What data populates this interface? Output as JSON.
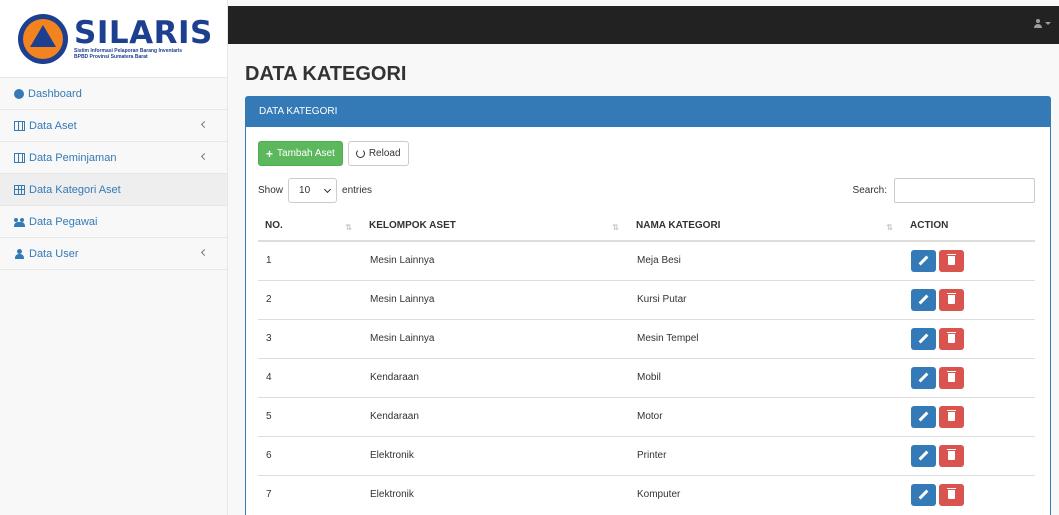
{
  "brand": {
    "title": "SILARIS",
    "subtitle_1": "Sistim Informasi Pelaporan Barang Inventaris",
    "subtitle_2": "BPBD Provinsi Sumatera Barat"
  },
  "sidebar": {
    "items": [
      {
        "label": "Dashboard",
        "icon": "dashboard-icon"
      },
      {
        "label": "Data Aset",
        "icon": "table-icon"
      },
      {
        "label": "Data Peminjaman",
        "icon": "table-icon"
      },
      {
        "label": "Data Kategori Aset",
        "icon": "grid-icon"
      },
      {
        "label": "Data Pegawai",
        "icon": "users-icon"
      },
      {
        "label": "Data User",
        "icon": "user-icon"
      }
    ]
  },
  "main": {
    "page_title": "DATA KATEGORI",
    "panel_title": "DATA KATEGORI",
    "add_button": "Tambah Aset",
    "reload_button": "Reload",
    "show_label": "Show",
    "entries_value": "10",
    "entries_label": "entries",
    "search_label": "Search:",
    "table": {
      "headers": [
        "NO.",
        "KELOMPOK ASET",
        "NAMA KATEGORI",
        "ACTION"
      ],
      "rows": [
        [
          "1",
          "Mesin Lainnya",
          "Meja Besi"
        ],
        [
          "2",
          "Mesin Lainnya",
          "Kursi Putar"
        ],
        [
          "3",
          "Mesin Lainnya",
          "Mesin Tempel"
        ],
        [
          "4",
          "Kendaraan",
          "Mobil"
        ],
        [
          "5",
          "Kendaraan",
          "Motor"
        ],
        [
          "6",
          "Elektronik",
          "Printer"
        ],
        [
          "7",
          "Elektronik",
          "Komputer"
        ]
      ]
    }
  },
  "colors": {
    "primary": "#337ab7",
    "success": "#5cb85c",
    "danger": "#d9534f",
    "topbar": "#222222"
  }
}
